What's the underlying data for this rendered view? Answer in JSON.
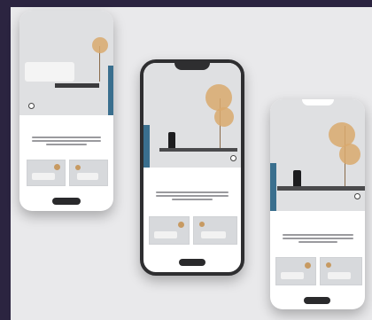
{
  "mockup": {
    "phones": [
      {
        "id": "left",
        "side_tag": "",
        "headline_1": "",
        "headline_2": "",
        "button_label": ""
      },
      {
        "id": "center",
        "side_tag": "",
        "headline_1": "",
        "headline_2": "",
        "button_label": ""
      },
      {
        "id": "right",
        "side_tag": "",
        "headline_1": "",
        "headline_2": "",
        "button_label": ""
      }
    ]
  },
  "colors": {
    "background": "#2b2440",
    "canvas": "#e9e9eb",
    "accent": "#3a6f8e",
    "button": "#2a2a2c",
    "plant": "#d9a96d"
  },
  "icons": [
    "phone-notch",
    "plus-icon",
    "pagination-dots"
  ]
}
